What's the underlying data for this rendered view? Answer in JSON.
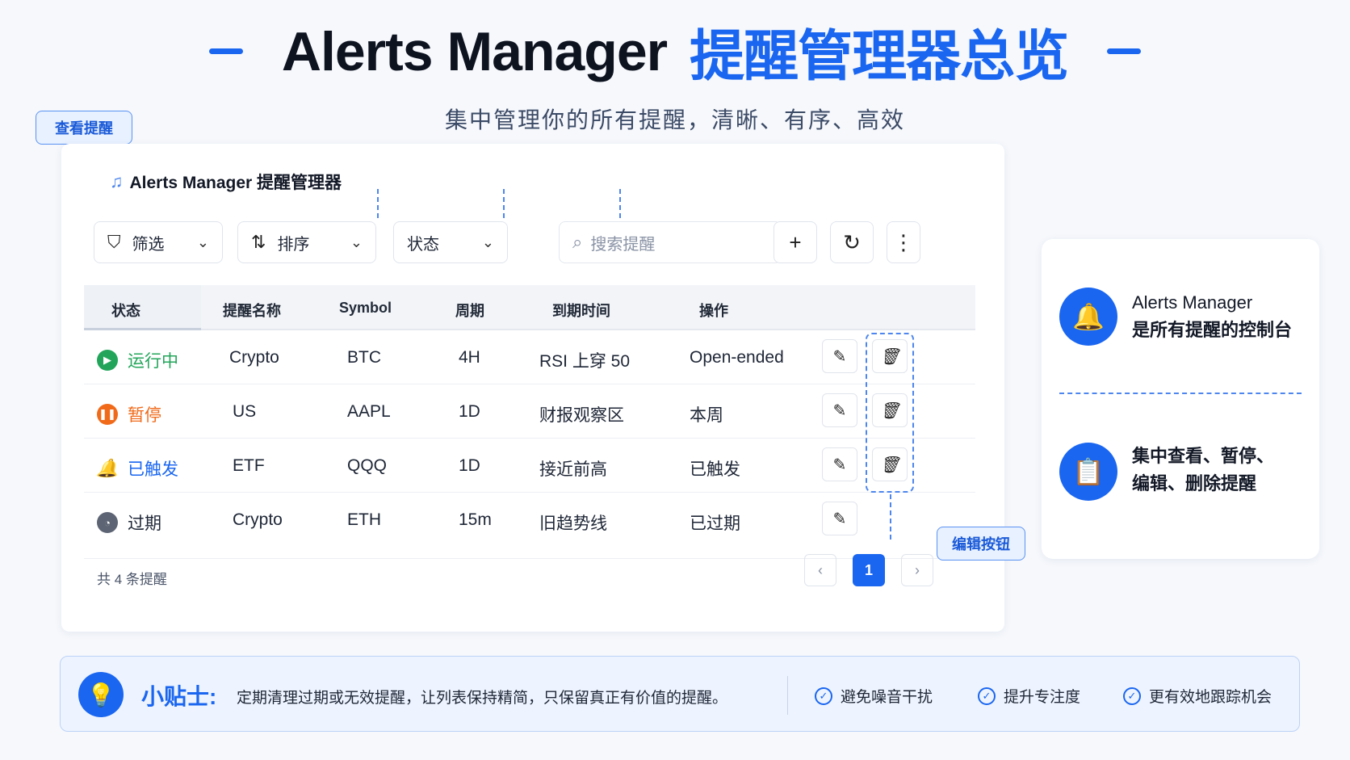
{
  "header": {
    "title_en": "Alerts Manager",
    "title_zh": "提醒管理器总览",
    "subtitle": "集中管理你的所有提醒，清晰、有序、高效"
  },
  "callouts": {
    "view": "查看提醒",
    "filter": "筛选",
    "sort": "排序",
    "status": "状态",
    "edit": "编辑按钮"
  },
  "panel": {
    "title": "Alerts Manager  提醒管理器",
    "toolbar": {
      "filter_label": "筛选",
      "sort_label": "排序",
      "status_label": "状态",
      "search_placeholder": "搜索提醒"
    },
    "columns": [
      "状态",
      "提醒名称",
      "Symbol",
      "周期",
      "到期时间",
      "操作"
    ],
    "rows": [
      {
        "status": "运行中",
        "status_color": "#22a55a",
        "name": "Crypto",
        "symbol": "BTC",
        "period": "4H",
        "condition": "RSI 上穿 50",
        "expiry": "Open-ended"
      },
      {
        "status": "暂停",
        "status_color": "#f06a1a",
        "name": "US",
        "symbol": "AAPL",
        "period": "1D",
        "condition": "财报观察区",
        "expiry": "本周"
      },
      {
        "status": "已触发",
        "status_color": "#1a66f0",
        "name": "ETF",
        "symbol": "QQQ",
        "period": "1D",
        "condition": "接近前高",
        "expiry": "已触发"
      },
      {
        "status": "过期",
        "status_color": "#5d6473",
        "name": "Crypto",
        "symbol": "ETH",
        "period": "15m",
        "condition": "旧趋势线",
        "expiry": "已过期"
      }
    ],
    "footer": "共 4 条提醒",
    "page": "1"
  },
  "side": {
    "line1": "Alerts Manager",
    "line2": "是所有提醒的控制台",
    "line3": "集中查看、暂停、",
    "line4": "编辑、删除提醒"
  },
  "tip": {
    "label": "小贴士:",
    "text": "定期清理过期或无效提醒，让列表保持精简，只保留真正有价值的提醒。",
    "bullets": [
      "避免噪音干扰",
      "提升专注度",
      "更有效地跟踪机会"
    ]
  },
  "colors": {
    "accent": "#1a66f0"
  }
}
